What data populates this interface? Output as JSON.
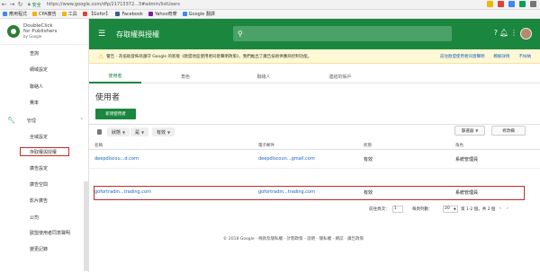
{
  "browser": {
    "secure_label": "安全",
    "url": "https://www.google.com/dfp/21713372...3#admin/listUsers",
    "bookmarks": [
      {
        "label": "應用程式",
        "color": "#4285f4"
      },
      {
        "label": "CPA廣告",
        "color": "#f4b400"
      },
      {
        "label": "工具",
        "color": "#f4b400"
      },
      {
        "label": "【Gofor】",
        "color": "#db4437"
      },
      {
        "label": "Facebook",
        "color": "#3b5998"
      },
      {
        "label": "Yahoo奇摩",
        "color": "#7b1fa2"
      },
      {
        "label": "Google 翻譯",
        "color": "#4285f4"
      }
    ]
  },
  "logo": {
    "line1": "DoubleClick",
    "line2": "for Publishers",
    "line3": "by Google"
  },
  "sidebar": {
    "items": [
      {
        "label": "查詢",
        "name": "sidebar-item-query"
      },
      {
        "label": "網域設定",
        "name": "sidebar-item-domain-settings"
      },
      {
        "label": "聯絡人",
        "name": "sidebar-item-contacts"
      },
      {
        "label": "費率",
        "name": "sidebar-item-rates"
      }
    ],
    "admin_label": "管理",
    "admin_items": [
      {
        "label": "全域設定",
        "name": "sidebar-item-global-settings"
      },
      {
        "label": "存取權與授權",
        "name": "sidebar-item-access",
        "active": true
      },
      {
        "label": "廣告設定",
        "name": "sidebar-item-ad-settings"
      },
      {
        "label": "廣告空間",
        "name": "sidebar-item-ad-space"
      },
      {
        "label": "影片廣告",
        "name": "sidebar-item-video-ads"
      },
      {
        "label": "公司",
        "name": "sidebar-item-companies"
      },
      {
        "label": "歐盟使用者同意聲明",
        "name": "sidebar-item-eu-consent"
      },
      {
        "label": "變更記錄",
        "name": "sidebar-item-change-log"
      }
    ]
  },
  "topbar": {
    "title": "存取權與授權",
    "colors": {
      "primary": "#1b873e",
      "search": "#4aa268"
    }
  },
  "banner": {
    "text": "警告 - 為協助發佈商遵守 Google 的新版《歐盟地區使用者同意聲明政策》，我們推出了廣告技術供應商控制功能。",
    "link1": "前往歐盟使用者同意聲明",
    "link2": "瞭解詳情",
    "link3": "不採納"
  },
  "tabs": [
    "使用者",
    "角色",
    "聯絡人",
    "連結的帳戶"
  ],
  "section_title": "使用者",
  "new_user_button": "新增使用者",
  "filters": [
    {
      "label": "狀態"
    },
    {
      "label": "是"
    },
    {
      "label": "有效"
    }
  ],
  "filter_buttons": {
    "select": "篩選器",
    "edit_columns": "修改欄"
  },
  "table": {
    "headers": {
      "name": "名稱",
      "email": "電子郵件",
      "status": "狀態",
      "role": "角色"
    },
    "rows": [
      {
        "name": "deepdiscou...d.com",
        "email": "deepdiscoun...gmail.com",
        "status": "有效",
        "role": "系統管理員"
      },
      {
        "name": "gofortradin...trading.com",
        "email": "gofortradin...trading.com",
        "status": "有效",
        "role": "系統管理員"
      }
    ]
  },
  "pager": {
    "goto_label": "前往頁次：",
    "page_value": "1",
    "per_page_label": "每頁列數：",
    "per_page_value": "20",
    "range_text": "第 1-2 個，共 2 個"
  },
  "footer": "© 2018 Google - 條款及隱私權 - 計劃政策 - 說明 - 隱私權 - 網誌 - 廣告政策"
}
